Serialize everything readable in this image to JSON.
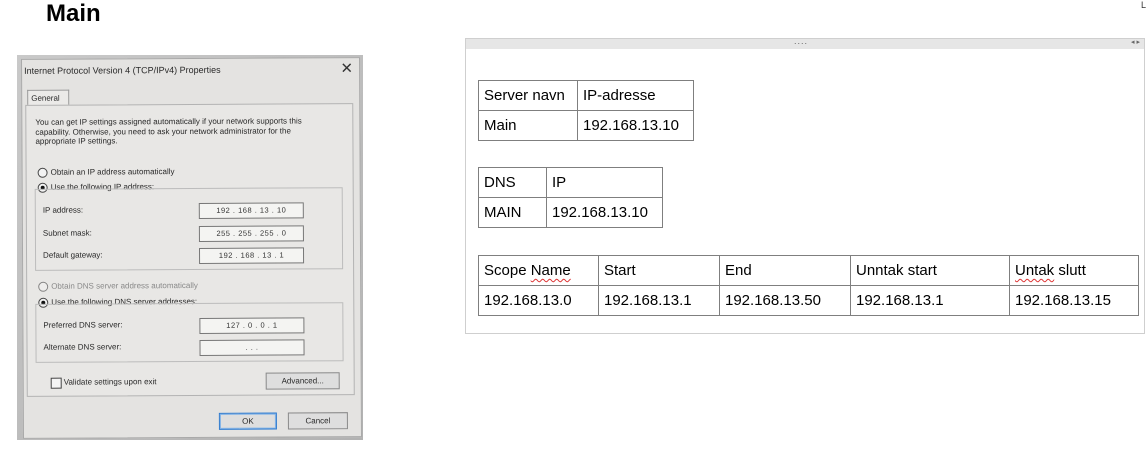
{
  "heading": "Main",
  "dialog": {
    "title": "Internet Protocol Version 4 (TCP/IPv4) Properties",
    "close_glyph": "✕",
    "tab": "General",
    "intro": "You can get IP settings assigned automatically if your network supports this capability. Otherwise, you need to ask your network administrator for the appropriate IP settings.",
    "obtain_ip_auto": "Obtain an IP address automatically",
    "use_following_ip": "Use the following IP address:",
    "ip_address_label": "IP address:",
    "ip_address": "192 . 168 . 13 . 10",
    "subnet_label": "Subnet mask:",
    "subnet": "255 . 255 . 255 . 0",
    "gateway_label": "Default gateway:",
    "gateway": "192 . 168 . 13 . 1",
    "obtain_dns_auto": "Obtain DNS server address automatically",
    "use_following_dns": "Use the following DNS server addresses:",
    "preferred_dns_label": "Preferred DNS server:",
    "preferred_dns": "127 . 0 . 0 . 1",
    "alternate_dns_label": "Alternate DNS server:",
    "alternate_dns": ".     .     .",
    "validate_label": "Validate settings upon exit",
    "advanced_label": "Advanced...",
    "ok_label": "OK",
    "cancel_label": "Cancel"
  },
  "panel": {
    "dots": "....",
    "arrows": "◂ ▸"
  },
  "server_table": {
    "headers": [
      "Server navn",
      "IP-adresse"
    ],
    "row": [
      "Main",
      "192.168.13.10"
    ]
  },
  "dns_table": {
    "headers": [
      "DNS",
      "IP"
    ],
    "row": [
      "MAIN",
      "192.168.13.10"
    ]
  },
  "scope_table": {
    "headers": [
      "Scope Name",
      "Start",
      "End",
      "Unntak start",
      "Untak slutt"
    ],
    "row": [
      "192.168.13.0",
      "192.168.13.1",
      "192.168.13.50",
      "192.168.13.1",
      "192.168.13.15"
    ]
  },
  "corner_mark": "L"
}
